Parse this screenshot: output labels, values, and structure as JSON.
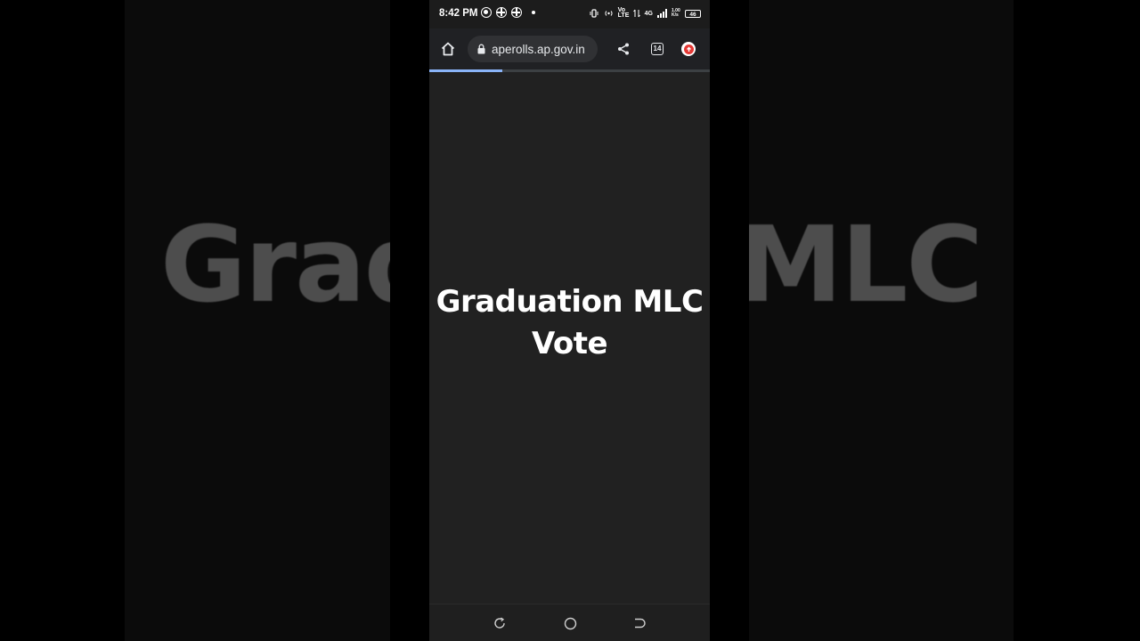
{
  "backdrop": {
    "left_text": "Grad",
    "right_text": "MLC"
  },
  "statusbar": {
    "time": "8:42 PM",
    "network_label": "4G",
    "volte_label": "Vo LTE",
    "speed_label": "1.00 K/s",
    "battery_level": "46"
  },
  "browser": {
    "url": "aperolls.ap.gov.in",
    "tab_count": "14",
    "load_progress": 0.26,
    "icons": {
      "home": "home-icon",
      "lock": "lock-icon",
      "share": "share-icon",
      "tabs": "tab-switcher-icon",
      "update": "update-icon"
    }
  },
  "page": {
    "headline_line1": "Graduation MLC",
    "headline_line2": "Vote"
  },
  "navbar": {
    "icons": [
      "recents-icon",
      "home-circle-icon",
      "back-icon"
    ]
  },
  "colors": {
    "screen_bg": "#212121",
    "toolbar_bg": "#202124",
    "url_pill_bg": "#303134",
    "progress": "#8ab4f8",
    "update_badge": "#e53935"
  }
}
